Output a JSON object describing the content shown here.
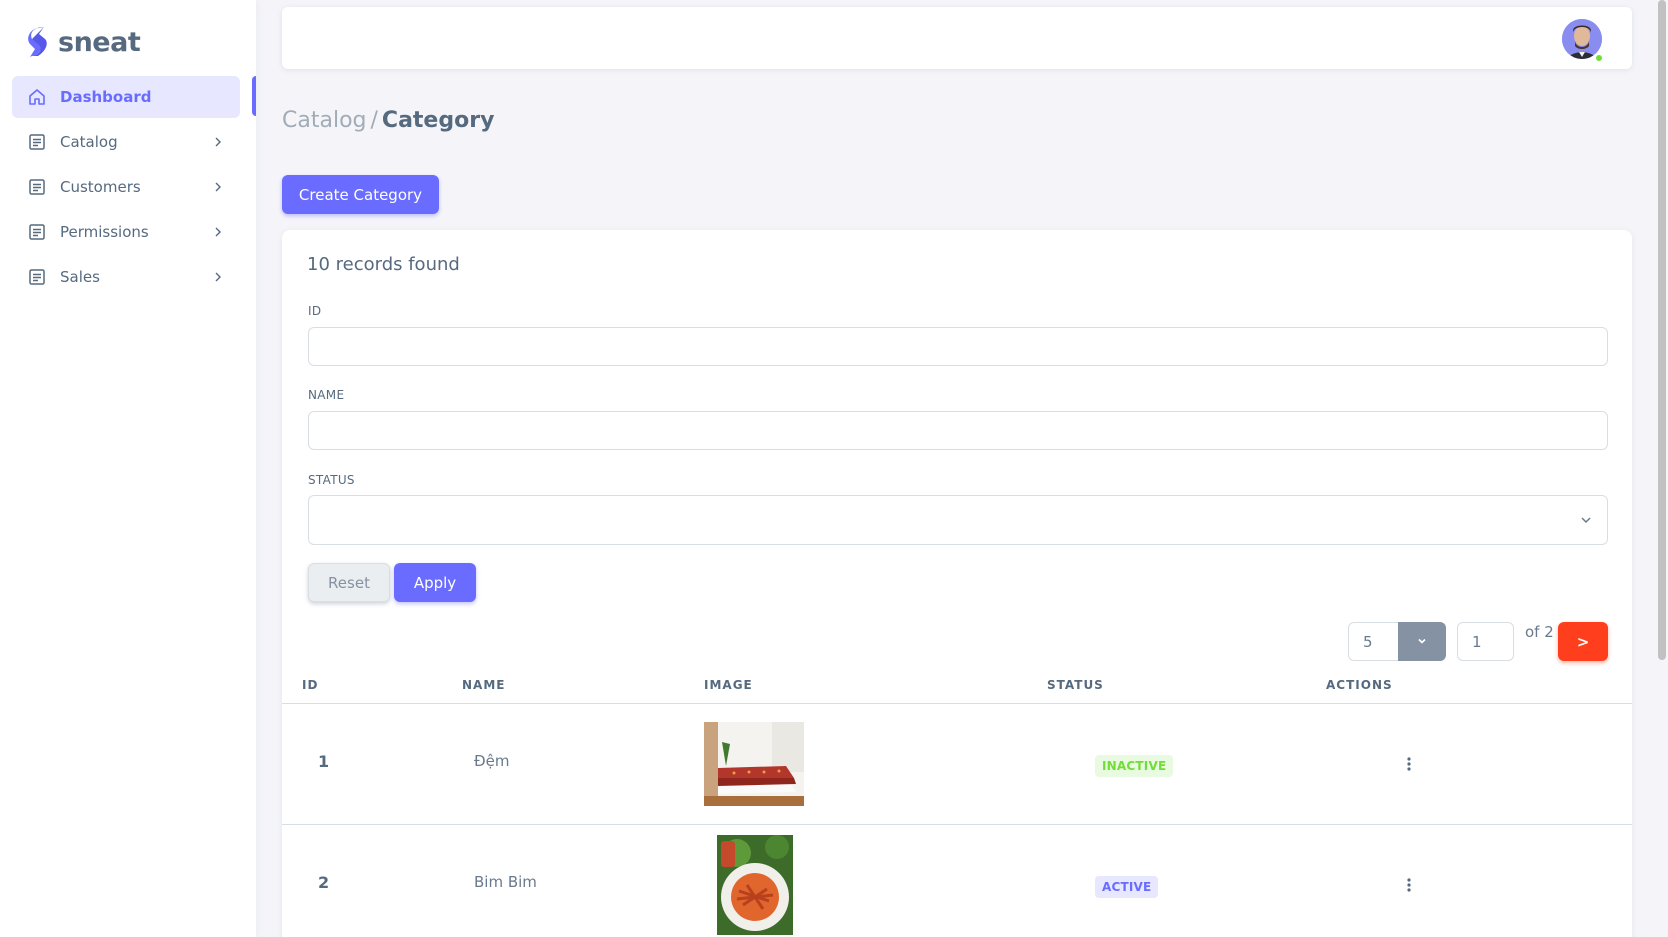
{
  "brand": {
    "name": "sneat"
  },
  "sidebar": {
    "items": [
      {
        "label": "Dashboard",
        "icon": "home-icon",
        "active": true
      },
      {
        "label": "Catalog",
        "icon": "list-icon"
      },
      {
        "label": "Customers",
        "icon": "list-icon"
      },
      {
        "label": "Permissions",
        "icon": "list-icon"
      },
      {
        "label": "Sales",
        "icon": "list-icon"
      }
    ]
  },
  "breadcrumb": {
    "parent": "Catalog",
    "separator": "/",
    "current": "Category"
  },
  "actions": {
    "create_label": "Create Category"
  },
  "filters": {
    "records_text": "10 records found",
    "id_label": "ID",
    "id_value": "",
    "name_label": "NAME",
    "name_value": "",
    "status_label": "STATUS",
    "status_value": "",
    "reset_label": "Reset",
    "apply_label": "Apply"
  },
  "pagination": {
    "per_page": "5",
    "current_page": "1",
    "of_total": "of 2",
    "next_label": ">"
  },
  "table": {
    "columns": [
      "ID",
      "NAME",
      "IMAGE",
      "STATUS",
      "ACTIONS"
    ],
    "rows": [
      {
        "id": "1",
        "name": "Đệm",
        "image": "mattress-photo",
        "status": "INACTIVE"
      },
      {
        "id": "2",
        "name": "Bim Bim",
        "image": "snack-plate-photo",
        "status": "ACTIVE"
      }
    ]
  },
  "colors": {
    "primary": "#696cff",
    "danger": "#ff3e1d",
    "success": "#71dd37",
    "secondary": "#8592a3"
  }
}
